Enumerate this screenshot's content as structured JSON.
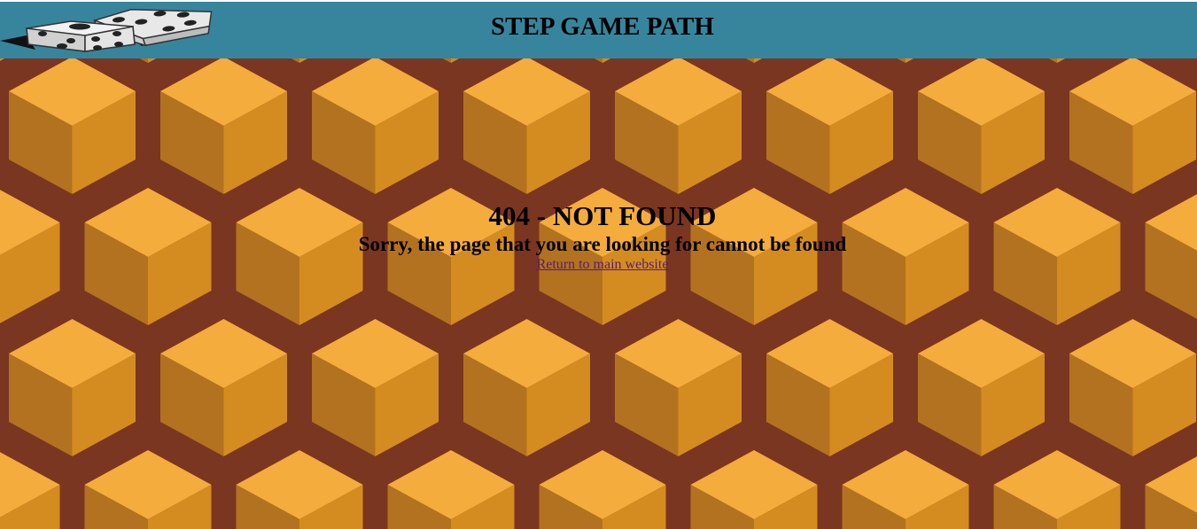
{
  "header": {
    "title": "STEP GAME PATH",
    "logo_icon": "dice-icon"
  },
  "error": {
    "title": "404 - NOT FOUND",
    "message": "Sorry, the page that you are looking for cannot be found",
    "link_label": "Return to main website"
  },
  "colors": {
    "header_bg": "#37859c",
    "hex_border": "#7a3620",
    "cube_top": "#f4ac3c",
    "cube_left": "#b3721f",
    "cube_right": "#d48c20",
    "link": "#5b1a78"
  }
}
